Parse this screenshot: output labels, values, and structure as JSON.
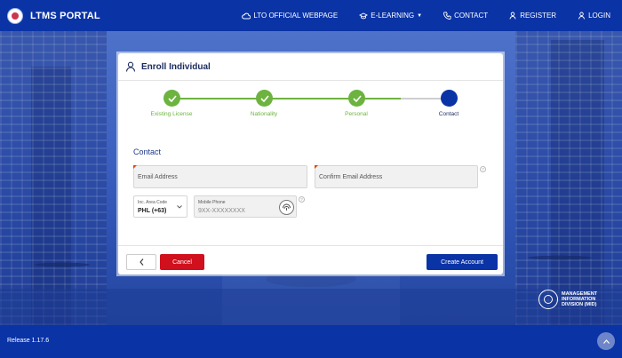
{
  "header": {
    "brand": "LTMS PORTAL",
    "nav": [
      {
        "label": "LTO OFFICIAL WEBPAGE",
        "icon": "cloud-icon"
      },
      {
        "label": "E-LEARNING",
        "icon": "graduation-cap-icon"
      },
      {
        "label": "CONTACT",
        "icon": "phone-icon"
      },
      {
        "label": "REGISTER",
        "icon": "user-plus-icon"
      },
      {
        "label": "LOGIN",
        "icon": "user-icon"
      }
    ]
  },
  "card": {
    "title": "Enroll Individual",
    "steps": [
      {
        "label": "Existing License",
        "status": "done"
      },
      {
        "label": "Nationality",
        "status": "done"
      },
      {
        "label": "Personal",
        "status": "done"
      },
      {
        "label": "Contact",
        "status": "active"
      }
    ],
    "section_title": "Contact",
    "email_placeholder": "Email Address",
    "confirm_email_placeholder": "Confirm Email Address",
    "area_code_label": "Inc. Area Code",
    "area_code_value": "PHL (+63)",
    "mobile_label": "Mobile Phone",
    "mobile_placeholder": "9XX-XXXXXXXX",
    "cancel_label": "Cancel",
    "create_label": "Create Account"
  },
  "mid_logo": {
    "line1": "MANAGEMENT",
    "line2": "INFORMATION",
    "line3": "DIVISION (MID)"
  },
  "footer": {
    "release": "Release 1.17.6"
  },
  "colors": {
    "primary": "#0a33a6",
    "success": "#6db33f",
    "danger": "#d0101c"
  }
}
